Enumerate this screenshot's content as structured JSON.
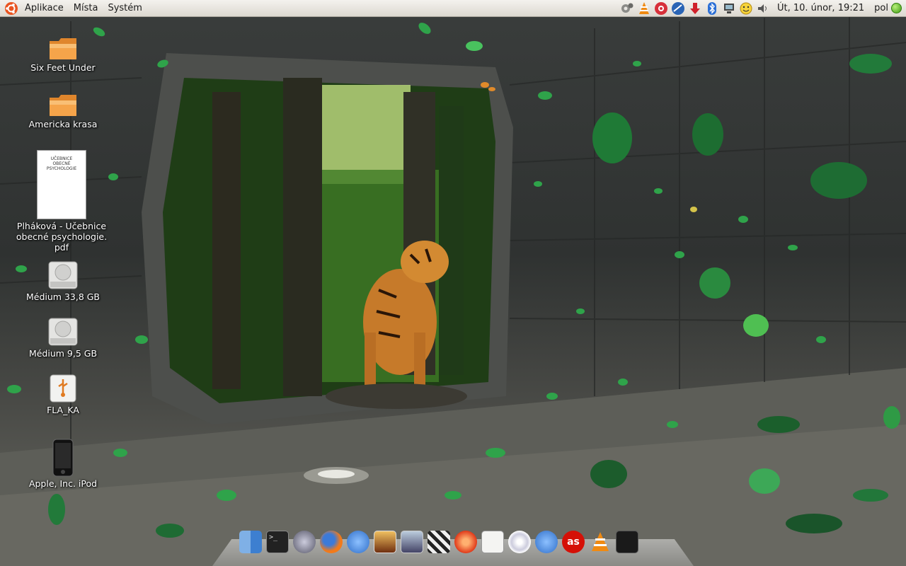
{
  "top_panel": {
    "menus": [
      "Aplikace",
      "Místa",
      "Systém"
    ],
    "clock": "Út, 10. únor, 19:21",
    "keyboard_layout": "pol",
    "tray_icons": [
      "update-gear-icon",
      "vlc-icon",
      "lifebuoy-icon",
      "globe-icon",
      "download-arrow-icon",
      "bluetooth-icon",
      "network-icon",
      "smiley-icon",
      "volume-icon"
    ]
  },
  "desktop": {
    "icons": [
      {
        "label": "Six Feet Under",
        "type": "folder"
      },
      {
        "label": "Americka krasa",
        "type": "folder"
      },
      {
        "label": "Plháková - Učebnice obecné psychologie. pdf",
        "type": "pdf",
        "thumb_title": "UČEBNICE OBECNÉ PSYCHOLOGIE"
      },
      {
        "label": "Médium 33,8 GB",
        "type": "drive"
      },
      {
        "label": "Médium 9,5 GB",
        "type": "drive"
      },
      {
        "label": "FLA_KA",
        "type": "usb"
      },
      {
        "label": "Apple, Inc. iPod",
        "type": "ipod"
      }
    ]
  },
  "dock": {
    "items": [
      "finder-icon",
      "terminal-icon",
      "audio-wave-icon",
      "firefox-icon",
      "pidgin-icon",
      "image-viewer-icon",
      "photo-preview-icon",
      "clapperboard-icon",
      "record-icon",
      "text-editor-icon",
      "music-cd-icon",
      "pidgin-icon",
      "lastfm-icon",
      "vlc-icon",
      "system-monitor-icon"
    ]
  },
  "colors": {
    "panel_top": "#f4f2ee",
    "panel_bottom": "#dcd8d0",
    "folder": "#f5a44a",
    "leaf": "#2fa34a"
  }
}
